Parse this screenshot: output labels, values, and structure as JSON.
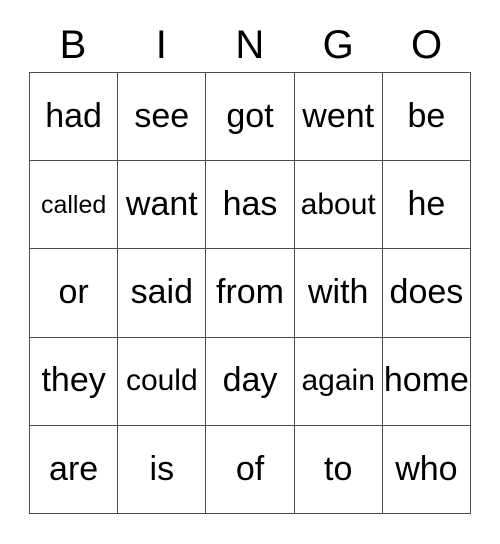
{
  "card": {
    "title": "BINGO",
    "headers": [
      "B",
      "I",
      "N",
      "G",
      "O"
    ],
    "rows": [
      [
        "had",
        "see",
        "got",
        "went",
        "be"
      ],
      [
        "called",
        "want",
        "has",
        "about",
        "he"
      ],
      [
        "or",
        "said",
        "from",
        "with",
        "does"
      ],
      [
        "they",
        "could",
        "day",
        "again",
        "home"
      ],
      [
        "are",
        "is",
        "of",
        "to",
        "who"
      ]
    ],
    "colors": {
      "text": "#000000",
      "border": "#4d4d4d",
      "background": "#ffffff"
    }
  }
}
